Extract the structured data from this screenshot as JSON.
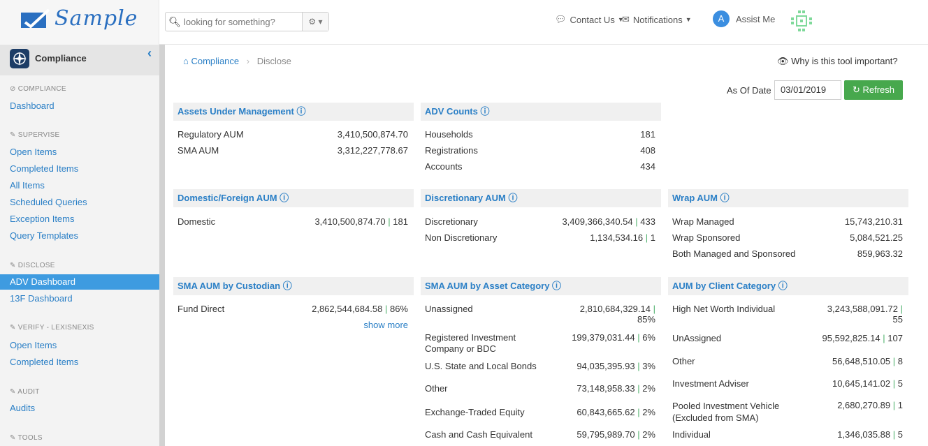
{
  "header": {
    "logo_text": "Sample",
    "search_placeholder": "looking for something?",
    "contact_label": "Contact Us",
    "notifications_label": "Notifications",
    "assist_avatar": "A",
    "assist_label": "Assist Me"
  },
  "sidebar": {
    "app_title": "Compliance",
    "sections": {
      "compliance": "COMPLIANCE",
      "supervise": "SUPERVISE",
      "disclose": "DISCLOSE",
      "verify": "VERIFY - LEXISNEXIS",
      "audit": "AUDIT",
      "tools": "TOOLS"
    },
    "items": {
      "dashboard": "Dashboard",
      "open_items": "Open Items",
      "completed_items": "Completed Items",
      "all_items": "All Items",
      "scheduled_queries": "Scheduled Queries",
      "exception_items": "Exception Items",
      "query_templates": "Query Templates",
      "adv_dashboard": "ADV Dashboard",
      "f13_dashboard": "13F Dashboard",
      "verify_open_items": "Open Items",
      "verify_completed_items": "Completed Items",
      "audits": "Audits"
    }
  },
  "main": {
    "breadcrumb": {
      "home": "Compliance",
      "current": "Disclose"
    },
    "why_label": "Why is this tool important?",
    "as_of_label": "As Of Date",
    "as_of_value": "03/01/2019",
    "refresh_label": "Refresh",
    "panels": {
      "aum": {
        "title": "Assets Under Management",
        "rows": [
          {
            "label": "Regulatory AUM",
            "value": "3,410,500,874.70"
          },
          {
            "label": "SMA AUM",
            "value": "3,312,227,778.67"
          }
        ]
      },
      "adv_counts": {
        "title": "ADV Counts",
        "rows": [
          {
            "label": "Households",
            "value": "181"
          },
          {
            "label": "Registrations",
            "value": "408"
          },
          {
            "label": "Accounts",
            "value": "434"
          }
        ]
      },
      "domestic": {
        "title": "Domestic/Foreign AUM",
        "rows": [
          {
            "label": "Domestic",
            "value": "3,410,500,874.70",
            "count": "181"
          }
        ]
      },
      "discretionary": {
        "title": "Discretionary AUM",
        "rows": [
          {
            "label": "Discretionary",
            "value": "3,409,366,340.54",
            "count": "433"
          },
          {
            "label": "Non Discretionary",
            "value": "1,134,534.16",
            "count": "1"
          }
        ]
      },
      "wrap": {
        "title": "Wrap AUM",
        "rows": [
          {
            "label": "Wrap Managed",
            "value": "15,743,210.31"
          },
          {
            "label": "Wrap Sponsored",
            "value": "5,084,521.25"
          },
          {
            "label": "Both Managed and Sponsored",
            "value": "859,963.32"
          }
        ]
      },
      "custodian": {
        "title": "SMA AUM by Custodian",
        "rows": [
          {
            "label": "Fund Direct",
            "value": "2,862,544,684.58",
            "count": "86%"
          }
        ],
        "show_more": "show more"
      },
      "asset_category": {
        "title": "SMA AUM by Asset Category",
        "rows": [
          {
            "label": "Unassigned",
            "value": "2,810,684,329.14",
            "count": "85%"
          },
          {
            "label": "Registered Investment Company or BDC",
            "value": "199,379,031.44",
            "count": "6%"
          },
          {
            "label": "U.S. State and Local Bonds",
            "value": "94,035,395.93",
            "count": "3%"
          },
          {
            "label": "Other",
            "value": "73,148,958.33",
            "count": "2%"
          },
          {
            "label": "Exchange-Traded Equity",
            "value": "60,843,665.62",
            "count": "2%"
          },
          {
            "label": "Cash and Cash Equivalent",
            "value": "59,795,989.70",
            "count": "2%"
          }
        ]
      },
      "client_category": {
        "title": "AUM by Client Category",
        "rows": [
          {
            "label": "High Net Worth Individual",
            "value": "3,243,588,091.72",
            "count": "55"
          },
          {
            "label": "UnAssigned",
            "value": "95,592,825.14",
            "count": "107"
          },
          {
            "label": "Other",
            "value": "56,648,510.05",
            "count": "8"
          },
          {
            "label": "Investment Adviser",
            "value": "10,645,141.02",
            "count": "5"
          },
          {
            "label": "Pooled Investment Vehicle (Excluded from SMA)",
            "value": "2,680,270.89",
            "count": "1"
          },
          {
            "label": "Individual",
            "value": "1,346,035.88",
            "count": "5"
          }
        ]
      }
    }
  }
}
